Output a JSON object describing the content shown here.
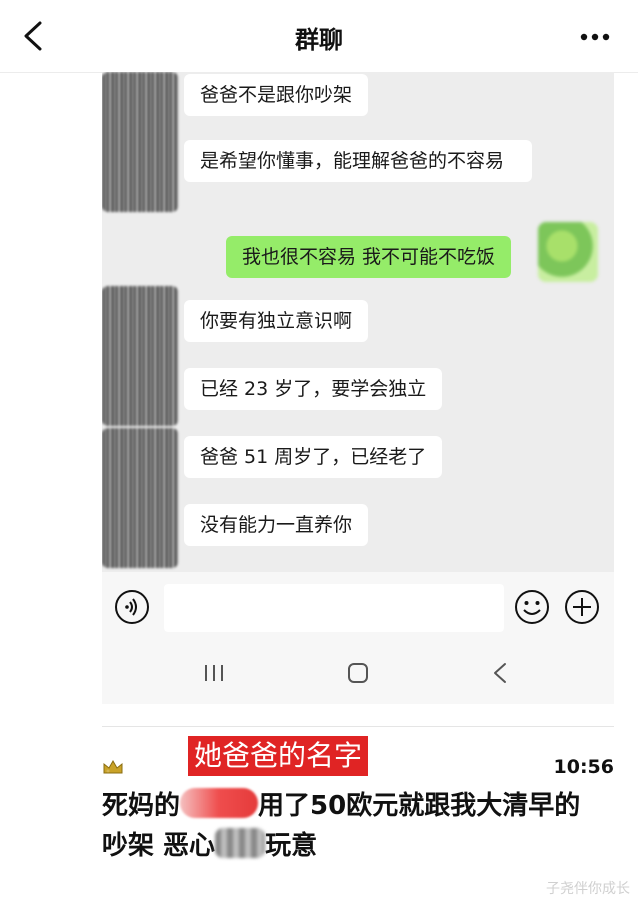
{
  "header": {
    "title": "群聊"
  },
  "messages": [
    {
      "side": "left",
      "text": "爸爸不是跟你吵架"
    },
    {
      "side": "left",
      "text": "是希望你懂事，能理解爸爸的不容易"
    },
    {
      "side": "right",
      "text": "我也很不容易 我不可能不吃饭"
    },
    {
      "side": "left",
      "text": "你要有独立意识啊"
    },
    {
      "side": "left",
      "text": "已经 23 岁了，要学会独立"
    },
    {
      "side": "left",
      "text": "爸爸 51 周岁了，已经老了"
    },
    {
      "side": "left",
      "text": "没有能力一直养你"
    }
  ],
  "input_bar": {
    "placeholder": ""
  },
  "icons": {
    "back": "chevron-left-icon",
    "more": "more-dots-icon",
    "voice": "voice-icon",
    "emoji": "emoji-icon",
    "plus": "plus-icon",
    "nav_recent": "recent-apps-icon",
    "nav_home": "home-icon",
    "nav_back": "nav-back-icon",
    "post_avatar": "crown-avatar-icon"
  },
  "post": {
    "name_tag": "她爸爸的名字",
    "time": "10:56",
    "line1_a": "死妈的",
    "line1_b": "用了50欧元就跟我大清早的",
    "line2_a": "吵架 恶心",
    "line2_b": "玩意"
  },
  "watermark": "子尧伴你成长",
  "colors": {
    "my_bubble": "#95ec69",
    "other_bubble": "#ffffff",
    "chat_bg": "#ededed",
    "name_tag_bg": "#e02424"
  }
}
